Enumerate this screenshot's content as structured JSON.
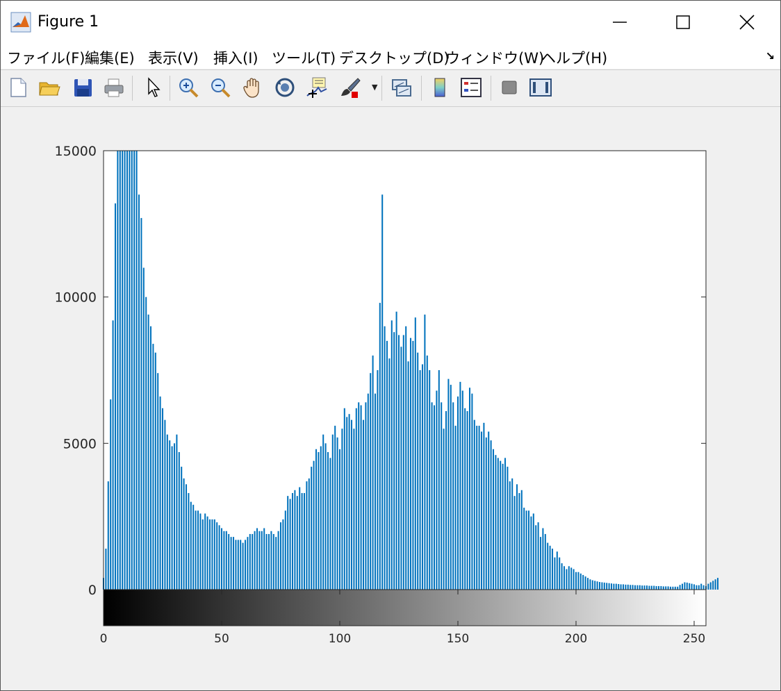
{
  "window": {
    "title": "Figure 1"
  },
  "menu": [
    "ファイル(F)",
    "編集(E)",
    "表示(V)",
    "挿入(I)",
    "ツール(T)",
    "デスクトップ(D)",
    "ウィンドウ(W)",
    "ヘルプ(H)"
  ],
  "toolbar": [
    "new-figure",
    "open-file",
    "save",
    "print",
    "edit-plot",
    "zoom-in",
    "zoom-out",
    "pan",
    "rotate-3d",
    "data-cursor",
    "brush",
    "link-plot",
    "insert-colorbar",
    "insert-legend",
    "hide-plot-tools",
    "show-plot-tools"
  ],
  "colors": {
    "bar": "#0072bd",
    "axes": "#262626",
    "background": "#f0f0f0"
  },
  "chart_data": {
    "type": "bar",
    "xlim": [
      0,
      255
    ],
    "ylim": [
      0,
      15000
    ],
    "xticks": [
      "0",
      "50",
      "100",
      "150",
      "200",
      "250"
    ],
    "yticks": [
      "0",
      "5000",
      "10000",
      "15000"
    ],
    "colorbar": "grayscale",
    "x_start": 0,
    "values": [
      400,
      1400,
      3700,
      6500,
      9200,
      13200,
      15000,
      15000,
      15000,
      15000,
      15000,
      15000,
      15000,
      15000,
      15000,
      13500,
      12700,
      11000,
      10000,
      9400,
      9000,
      8400,
      8100,
      7400,
      6600,
      6200,
      5800,
      5300,
      5100,
      4900,
      5000,
      5300,
      4700,
      4200,
      3800,
      3600,
      3300,
      3000,
      2900,
      2700,
      2700,
      2600,
      2400,
      2600,
      2500,
      2400,
      2400,
      2400,
      2300,
      2200,
      2100,
      2000,
      2000,
      1900,
      1800,
      1800,
      1700,
      1700,
      1700,
      1600,
      1700,
      1800,
      1900,
      1900,
      2000,
      2100,
      2000,
      2000,
      2100,
      1900,
      1900,
      2000,
      1900,
      1800,
      2000,
      2300,
      2400,
      2700,
      3200,
      3100,
      3300,
      3400,
      3200,
      3500,
      3300,
      3300,
      3700,
      3800,
      4200,
      4400,
      4800,
      4700,
      4900,
      5300,
      5000,
      4700,
      4500,
      5300,
      5600,
      5200,
      4800,
      5500,
      6200,
      5900,
      6000,
      5800,
      5500,
      6200,
      6400,
      6300,
      5800,
      6400,
      6700,
      7400,
      8000,
      6700,
      7500,
      9800,
      13500,
      9000,
      8500,
      7900,
      9200,
      8800,
      9500,
      8700,
      8300,
      8700,
      9000,
      7800,
      8600,
      8500,
      9300,
      8100,
      7500,
      7700,
      9400,
      8000,
      7500,
      6400,
      6300,
      6800,
      7500,
      6400,
      5500,
      6100,
      7200,
      7000,
      6400,
      5600,
      6600,
      7100,
      6800,
      6200,
      6100,
      6900,
      6700,
      5800,
      5600,
      5600,
      5400,
      5700,
      5200,
      5400,
      5100,
      4800,
      4600,
      4500,
      4400,
      4300,
      4500,
      4200,
      3700,
      3800,
      3200,
      3600,
      3300,
      3400,
      2800,
      2700,
      2700,
      2500,
      2600,
      2200,
      2300,
      1800,
      2100,
      1900,
      1600,
      1500,
      1400,
      1100,
      1300,
      1100,
      900,
      800,
      700,
      800,
      750,
      700,
      600,
      600,
      550,
      500,
      450,
      400,
      350,
      320,
      300,
      280,
      260,
      250,
      240,
      230,
      220,
      210,
      200,
      200,
      190,
      180,
      180,
      170,
      170,
      160,
      160,
      150,
      150,
      150,
      140,
      140,
      140,
      130,
      130,
      130,
      120,
      120,
      120,
      110,
      110,
      110,
      100,
      100,
      100,
      100,
      160,
      200,
      250,
      240,
      220,
      200,
      180,
      150,
      150,
      200,
      150,
      120,
      200,
      250,
      300,
      350,
      400
    ]
  }
}
